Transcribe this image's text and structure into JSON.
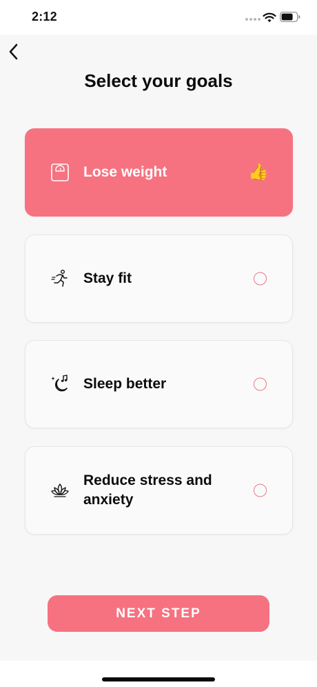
{
  "status_bar": {
    "time": "2:12"
  },
  "header": {
    "back_icon": "chevron-left-icon",
    "title": "Select your goals"
  },
  "goals": [
    {
      "label": "Lose weight",
      "icon": "scale-icon",
      "selected": true,
      "selected_mark": "👍"
    },
    {
      "label": "Stay fit",
      "icon": "running-person-icon",
      "selected": false
    },
    {
      "label": "Sleep better",
      "icon": "moon-stars-icon",
      "selected": false
    },
    {
      "label": "Reduce stress and anxiety",
      "icon": "lotus-icon",
      "selected": false
    }
  ],
  "next_button": {
    "label": "NEXT STEP"
  },
  "colors": {
    "accent": "#f67280",
    "background": "#f7f7f7",
    "card": "#fafafa",
    "text": "#0b0b0b"
  }
}
